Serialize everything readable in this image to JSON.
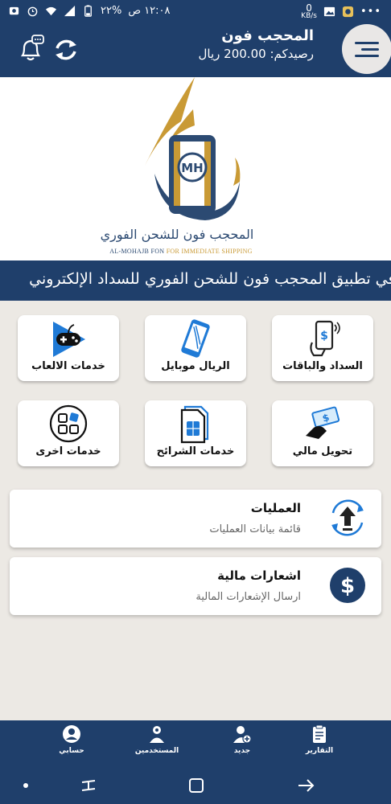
{
  "status_bar": {
    "time": "١٢:٠٨ ص",
    "battery": "%٢٢",
    "dots": "•••",
    "speed_value": "0",
    "speed_unit": "KB/s"
  },
  "header": {
    "title": "المحجب فون",
    "balance": "رصيدكم: 200.00 ريال",
    "colors": {
      "primary": "#1f3f6b",
      "accent": "#c99a35"
    }
  },
  "logo": {
    "arabic": "المحجب فون للشحن الفوري",
    "english_main": "AL-MOHAJB FON ",
    "english_accent": "FOR IMMEDIATE SHIPPING",
    "mark_text": "MH"
  },
  "marquee": {
    "text": "مرحباً بكم في تطبيق المحجب فون للشحن الفوري للسداد الإلكتروني"
  },
  "tiles": [
    {
      "label": "السداد والباقات",
      "icon": "phone-payment-icon"
    },
    {
      "label": "الريال موبايل",
      "icon": "mobile-phone-icon"
    },
    {
      "label": "خدمات الالعاب",
      "icon": "game-controller-icon"
    },
    {
      "label": "تحويل  مالي",
      "icon": "money-transfer-icon"
    },
    {
      "label": "خدمات الشرائح",
      "icon": "sim-cards-icon"
    },
    {
      "label": "خدمات اخرى",
      "icon": "grid-apps-icon"
    }
  ],
  "cards": [
    {
      "title": "العمليات",
      "subtitle": "قائمة بيانات العمليات",
      "icon": "operations-upload-icon"
    },
    {
      "title": "اشعارات مالية",
      "subtitle": "ارسال الإشعارات المالية",
      "icon": "dollar-circle-icon"
    }
  ],
  "bottom_nav": [
    {
      "label": "حسابي",
      "icon": "user-circle-icon"
    },
    {
      "label": "المستخدمين",
      "icon": "users-gear-icon"
    },
    {
      "label": "جديد",
      "icon": "add-user-icon"
    },
    {
      "label": "التقارير",
      "icon": "clipboard-report-icon"
    }
  ]
}
